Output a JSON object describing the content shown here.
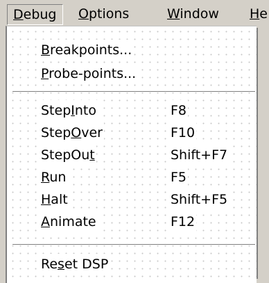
{
  "menubar": {
    "items": [
      {
        "label": "Debug",
        "accel": "D",
        "rest": "ebug"
      },
      {
        "label": "Options",
        "accel": "O",
        "rest": "ptions"
      },
      {
        "label": "Window",
        "accel": "W",
        "rest": "indow"
      },
      {
        "label": "He",
        "accel": "H",
        "rest": "e"
      }
    ]
  },
  "menu": {
    "breakpoints": {
      "pre": "",
      "accel": "B",
      "post": "reakpoints..."
    },
    "probe_points": {
      "pre": "",
      "accel": "P",
      "post": "robe-points..."
    },
    "step_into": {
      "pre": "Step",
      "accel": "I",
      "post": "nto",
      "shortcut": "F8"
    },
    "step_over": {
      "pre": "Step",
      "accel": "O",
      "post": "ver",
      "shortcut": "F10"
    },
    "step_out": {
      "pre": "StepOu",
      "accel": "t",
      "post": "",
      "shortcut": "Shift+F7"
    },
    "run": {
      "pre": "",
      "accel": "R",
      "post": "un",
      "shortcut": "F5"
    },
    "halt": {
      "pre": "",
      "accel": "H",
      "post": "alt",
      "shortcut": "Shift+F5"
    },
    "animate": {
      "pre": "",
      "accel": "A",
      "post": "nimate",
      "shortcut": "F12"
    },
    "reset_dsp": {
      "pre": "Re",
      "accel": "s",
      "post": "et DSP"
    }
  }
}
